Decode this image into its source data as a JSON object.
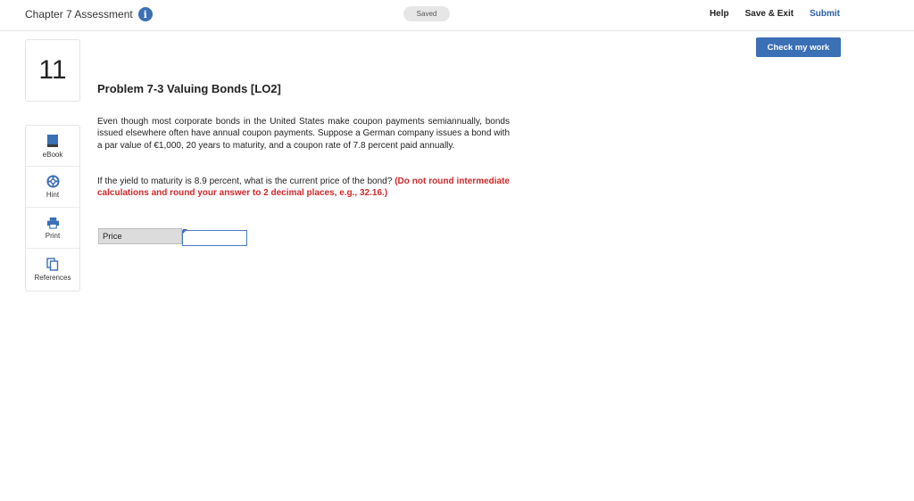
{
  "header": {
    "title": "Chapter 7 Assessment",
    "saved_status": "Saved",
    "help": "Help",
    "save_exit": "Save & Exit",
    "submit": "Submit"
  },
  "check_my_work": "Check my work",
  "question_number": "11",
  "tools": [
    {
      "label": "eBook",
      "icon": "book-icon"
    },
    {
      "label": "Hint",
      "icon": "lifebuoy-icon"
    },
    {
      "label": "Print",
      "icon": "printer-icon"
    },
    {
      "label": "References",
      "icon": "documents-icon"
    }
  ],
  "problem": {
    "title": "Problem 7-3 Valuing Bonds [LO2]",
    "paragraph1": "Even though most corporate bonds in the United States make coupon payments semiannually, bonds issued elsewhere often have annual coupon payments. Suppose a German company issues a bond with a par value of €1,000, 20 years to maturity, and a coupon rate of 7.8 percent paid annually.",
    "paragraph2_text": "If the yield to maturity is 8.9 percent, what is the current price of the bond? ",
    "paragraph2_instruction": "(Do not round intermediate calculations and round your answer to 2 decimal places, e.g., 32.16.)"
  },
  "answer": {
    "label": "Price",
    "value": ""
  },
  "colors": {
    "accent": "#3b6fb6",
    "instruction_red": "#d0282a"
  }
}
